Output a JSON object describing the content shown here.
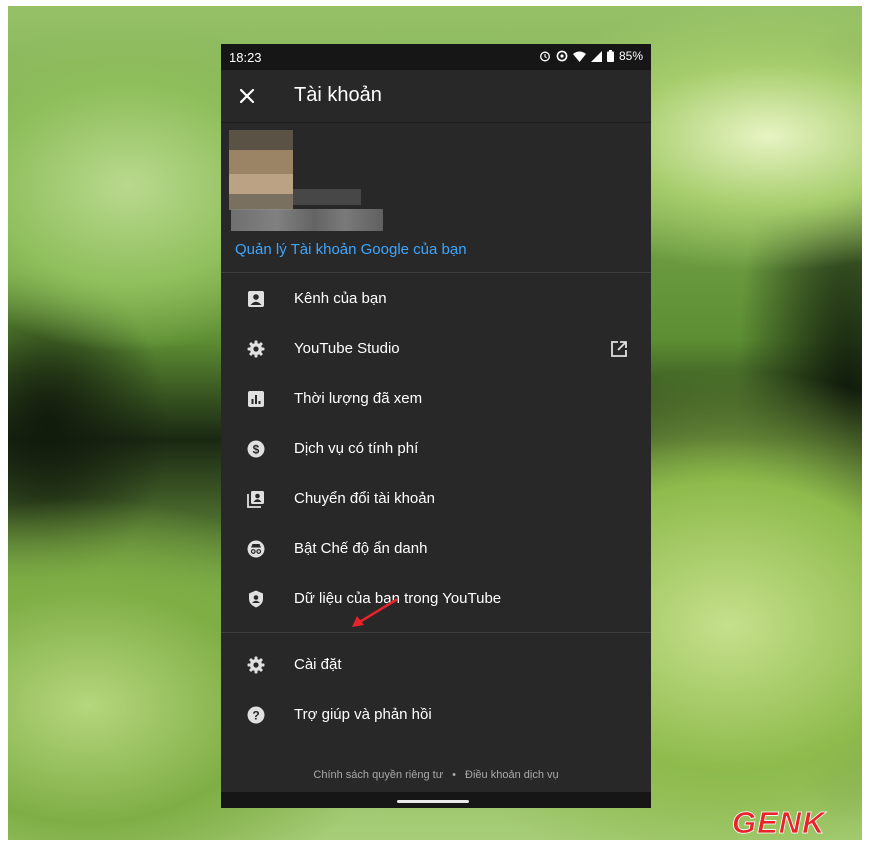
{
  "status_bar": {
    "time": "18:23",
    "battery": "85%"
  },
  "header": {
    "title": "Tài khoản",
    "close_icon": "close-icon"
  },
  "account": {
    "manage_link": "Quản lý Tài khoản Google của bạn"
  },
  "menu_group_1": [
    {
      "label": "Kênh của bạn",
      "icon": "account-box-icon"
    },
    {
      "label": "YouTube Studio",
      "icon": "gear-icon",
      "trailing_icon": "open-external-icon"
    },
    {
      "label": "Thời lượng đã xem",
      "icon": "bar-chart-icon"
    },
    {
      "label": "Dịch vụ có tính phí",
      "icon": "dollar-circle-icon"
    },
    {
      "label": "Chuyển đổi tài khoản",
      "icon": "switch-account-icon"
    },
    {
      "label": "Bật Chế độ ẩn danh",
      "icon": "incognito-icon"
    },
    {
      "label": "Dữ liệu của bạn trong YouTube",
      "icon": "shield-person-icon"
    }
  ],
  "menu_group_2": [
    {
      "label": "Cài đặt",
      "icon": "gear-icon"
    },
    {
      "label": "Trợ giúp và phản hồi",
      "icon": "help-circle-icon"
    }
  ],
  "footer": {
    "privacy": "Chính sách quyền riêng tư",
    "separator": "•",
    "terms": "Điều khoản dịch vụ"
  },
  "watermark": {
    "text": "GENK"
  },
  "colors": {
    "panel": "#282828",
    "link": "#3ea6ff",
    "arrow": "#e8232a",
    "logo": "#e8232a"
  }
}
